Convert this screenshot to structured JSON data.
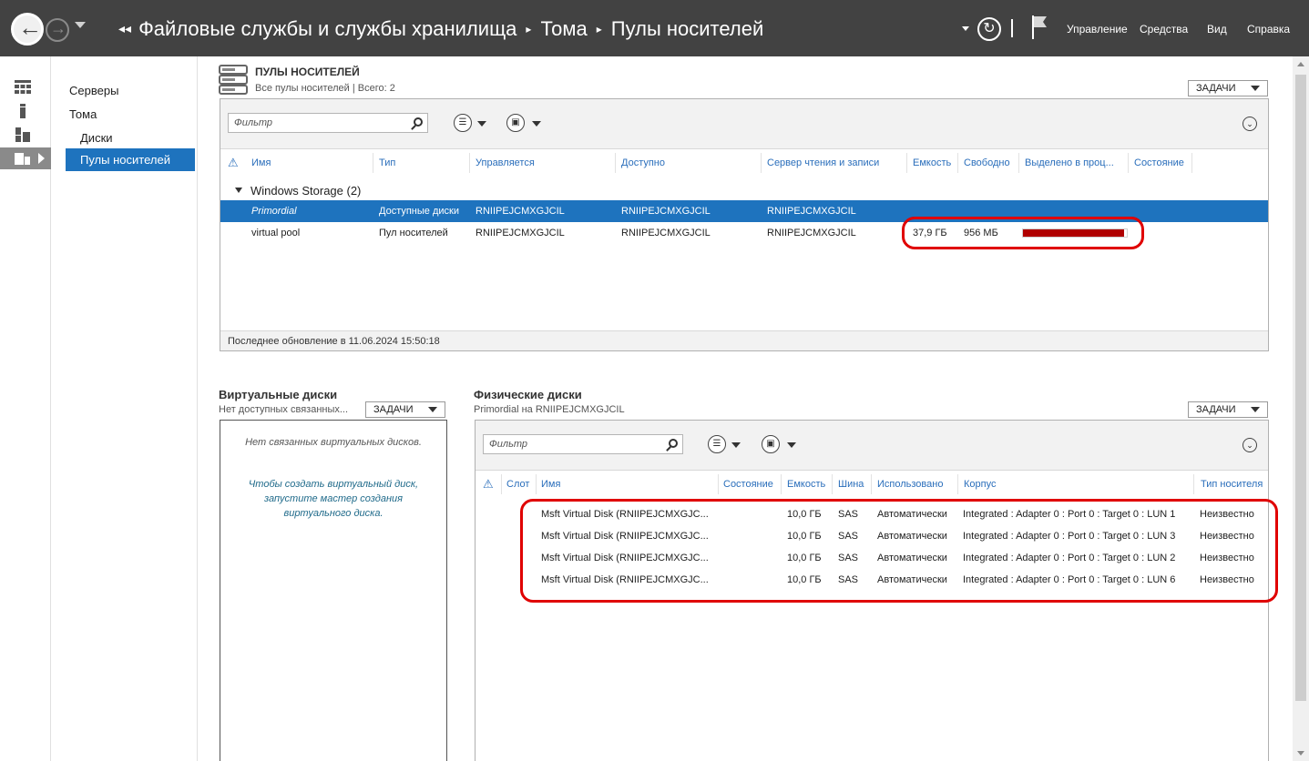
{
  "breadcrumb": [
    "Файловые службы и службы хранилища",
    "Тома",
    "Пулы носителей"
  ],
  "top_menu": [
    "Управление",
    "Средства",
    "Вид",
    "Справка"
  ],
  "nav": {
    "items": [
      "Серверы",
      "Тома",
      "Диски",
      "Пулы носителей"
    ]
  },
  "pools": {
    "title": "ПУЛЫ НОСИТЕЛЕЙ",
    "subtitle": "Все пулы носителей | Всего: 2",
    "tasks_label": "ЗАДАЧИ",
    "filter_placeholder": "Фильтр",
    "columns": [
      "Имя",
      "Тип",
      "Управляется",
      "Доступно",
      "Сервер чтения и записи",
      "Емкость",
      "Свободно",
      "Выделено в проц...",
      "Состояние"
    ],
    "group_label": "Windows Storage (2)",
    "rows": [
      {
        "name": "Primordial",
        "type": "Доступные диски",
        "managed": "RNIIPEJCMXGJCIL",
        "available": "RNIIPEJCMXGJCIL",
        "rw_server": "RNIIPEJCMXGJCIL",
        "capacity": "",
        "free": "",
        "allocated_percent": null,
        "state": ""
      },
      {
        "name": "virtual pool",
        "type": "Пул носителей",
        "managed": "RNIIPEJCMXGJCIL",
        "available": "RNIIPEJCMXGJCIL",
        "rw_server": "RNIIPEJCMXGJCIL",
        "capacity": "37,9 ГБ",
        "free": "956 МБ",
        "allocated_percent": 97.5,
        "state": ""
      }
    ],
    "last_update": "Последнее обновление в 11.06.2024 15:50:18"
  },
  "virtual_disks": {
    "title": "Виртуальные диски",
    "subtitle": "Нет доступных связанных...",
    "tasks_label": "ЗАДАЧИ",
    "empty_message": "Нет связанных виртуальных дисков.",
    "hint": "Чтобы создать виртуальный диск, запустите мастер создания виртуального диска."
  },
  "physical_disks": {
    "title": "Физические диски",
    "subtitle": "Primordial на RNIIPEJCMXGJCIL",
    "tasks_label": "ЗАДАЧИ",
    "filter_placeholder": "Фильтр",
    "columns": [
      "Слот",
      "Имя",
      "Состояние",
      "Емкость",
      "Шина",
      "Использовано",
      "Корпус",
      "Тип носителя"
    ],
    "rows": [
      {
        "name": "Msft Virtual Disk (RNIIPEJCMXGJC...",
        "capacity": "10,0 ГБ",
        "bus": "SAS",
        "usage": "Автоматически",
        "chassis": "Integrated : Adapter 0 : Port 0 : Target 0 : LUN 1",
        "media": "Неизвестно"
      },
      {
        "name": "Msft Virtual Disk (RNIIPEJCMXGJC...",
        "capacity": "10,0 ГБ",
        "bus": "SAS",
        "usage": "Автоматически",
        "chassis": "Integrated : Adapter 0 : Port 0 : Target 0 : LUN 3",
        "media": "Неизвестно"
      },
      {
        "name": "Msft Virtual Disk (RNIIPEJCMXGJC...",
        "capacity": "10,0 ГБ",
        "bus": "SAS",
        "usage": "Автоматически",
        "chassis": "Integrated : Adapter 0 : Port 0 : Target 0 : LUN 2",
        "media": "Неизвестно"
      },
      {
        "name": "Msft Virtual Disk (RNIIPEJCMXGJC...",
        "capacity": "10,0 ГБ",
        "bus": "SAS",
        "usage": "Автоматически",
        "chassis": "Integrated : Adapter 0 : Port 0 : Target 0 : LUN 6",
        "media": "Неизвестно"
      }
    ]
  },
  "colors": {
    "topbar": "#424242",
    "selection": "#1e73be",
    "header_text": "#2a6ebb",
    "alloc_bar": "#b00000",
    "highlight": "#e00000"
  }
}
